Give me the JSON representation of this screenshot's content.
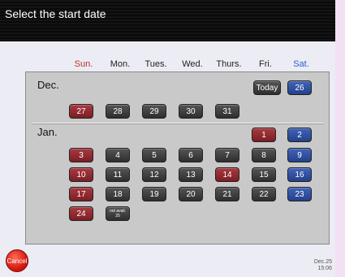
{
  "header": {
    "title": "Select the start date"
  },
  "weekdays": [
    "Sun.",
    "Mon.",
    "Tues.",
    "Wed.",
    "Thurs.",
    "Fri.",
    "Sat."
  ],
  "dec": {
    "label": "Dec.",
    "today_label": "Today",
    "days": [
      "26",
      "27",
      "28",
      "29",
      "30",
      "31"
    ]
  },
  "jan": {
    "label": "Jan.",
    "days": [
      "1",
      "2",
      "3",
      "4",
      "5",
      "6",
      "7",
      "8",
      "9",
      "10",
      "11",
      "12",
      "13",
      "14",
      "15",
      "16",
      "17",
      "18",
      "19",
      "20",
      "21",
      "22",
      "23",
      "24",
      "25"
    ],
    "day25_note": "not avail."
  },
  "footer": {
    "cancel_label": "Cancel",
    "clock_date": "Dec.25",
    "clock_time": "15:06"
  },
  "colors": {
    "weekday": "#3a3a3a",
    "sunday_holiday": "#8e2a30",
    "saturday": "#2f4f9e"
  }
}
